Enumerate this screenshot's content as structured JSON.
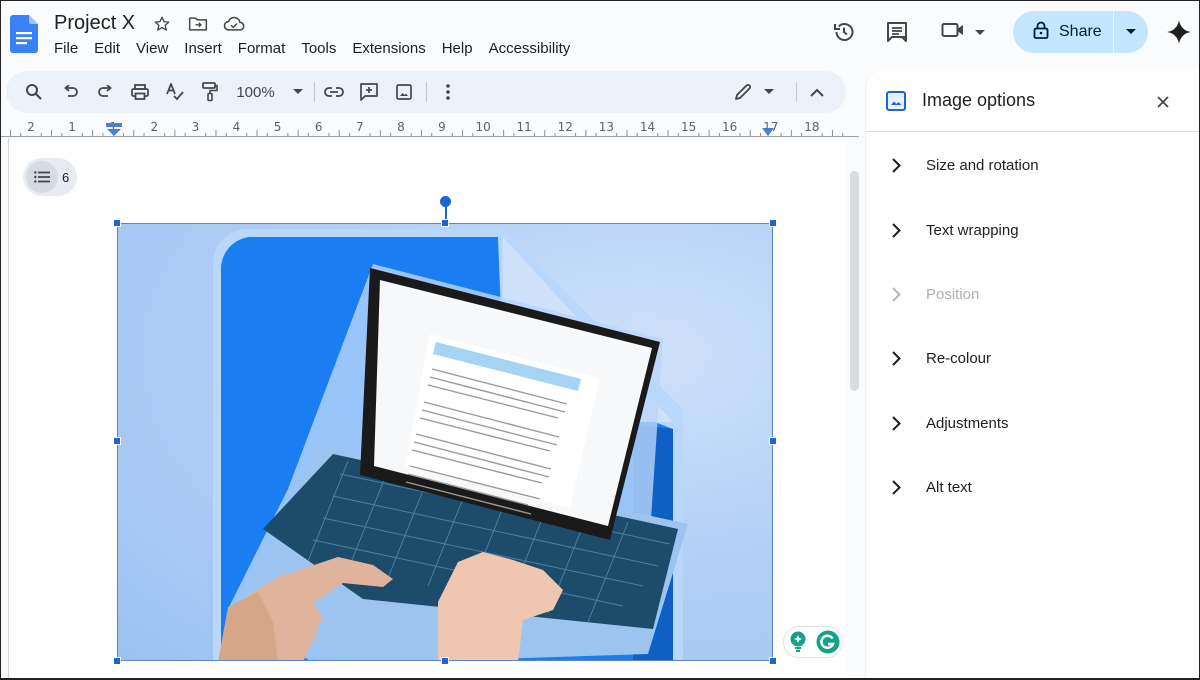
{
  "header": {
    "title": "Project X",
    "menu": [
      "File",
      "Edit",
      "View",
      "Insert",
      "Format",
      "Tools",
      "Extensions",
      "Help",
      "Accessibility"
    ],
    "share_label": "Share"
  },
  "toolbar": {
    "zoom": "100%"
  },
  "ruler": {
    "labels": [
      "2",
      "1",
      "1",
      "2",
      "3",
      "4",
      "5",
      "6",
      "7",
      "8",
      "9",
      "10",
      "11",
      "12",
      "13",
      "14",
      "15",
      "16",
      "17",
      "18"
    ]
  },
  "document": {
    "outline_count": "6"
  },
  "panel": {
    "title": "Image options",
    "sections": [
      {
        "label": "Size and rotation",
        "enabled": true
      },
      {
        "label": "Text wrapping",
        "enabled": true
      },
      {
        "label": "Position",
        "enabled": false
      },
      {
        "label": "Re-colour",
        "enabled": true
      },
      {
        "label": "Adjustments",
        "enabled": true
      },
      {
        "label": "Alt text",
        "enabled": true
      }
    ]
  },
  "colors": {
    "accent": "#1a66d2",
    "share_bg": "#c2e7ff",
    "toolbar_bg": "#edf2fa",
    "grammarly": "#15a386"
  }
}
